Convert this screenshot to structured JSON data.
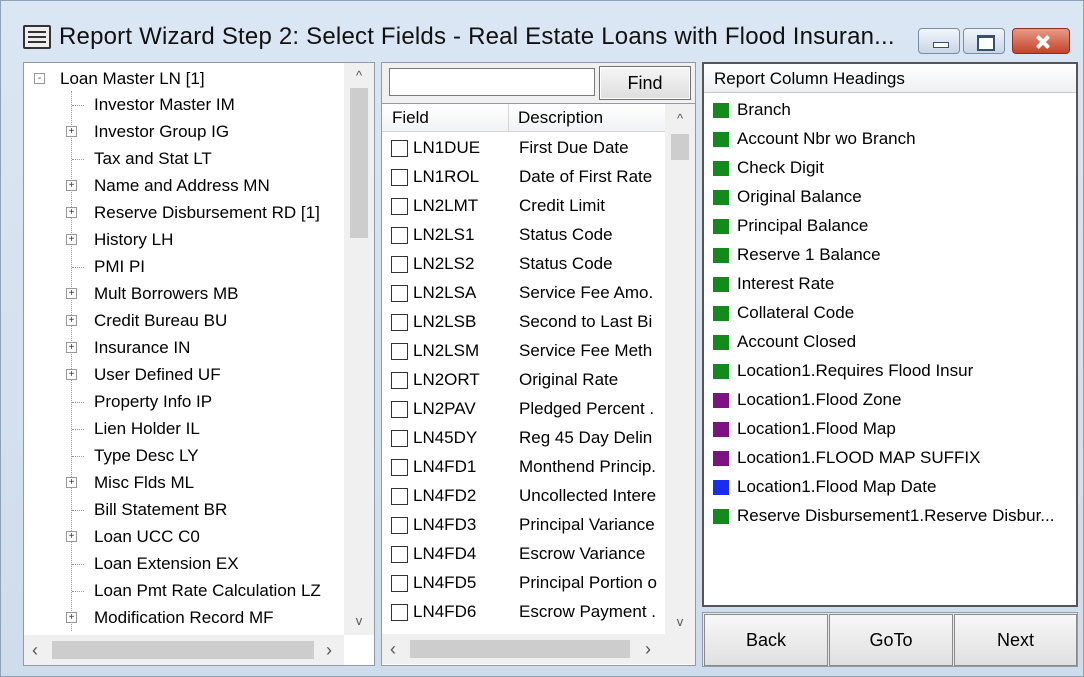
{
  "window": {
    "title": "Report Wizard Step 2:  Select Fields - Real Estate Loans with Flood Insuran..."
  },
  "tree": {
    "items": [
      {
        "label": "Loan Master LN [1]",
        "expander": "minus",
        "root": true
      },
      {
        "label": "Investor Master IM",
        "expander": ""
      },
      {
        "label": "Investor Group IG",
        "expander": "plus"
      },
      {
        "label": "Tax and Stat LT",
        "expander": ""
      },
      {
        "label": "Name and Address MN",
        "expander": "plus"
      },
      {
        "label": "Reserve Disbursement RD [1]",
        "expander": "plus"
      },
      {
        "label": "History LH",
        "expander": "plus"
      },
      {
        "label": "PMI PI",
        "expander": ""
      },
      {
        "label": "Mult Borrowers MB",
        "expander": "plus"
      },
      {
        "label": "Credit Bureau BU",
        "expander": "plus"
      },
      {
        "label": "Insurance IN",
        "expander": "plus"
      },
      {
        "label": "User Defined UF",
        "expander": "plus"
      },
      {
        "label": "Property Info IP",
        "expander": ""
      },
      {
        "label": "Lien Holder IL",
        "expander": ""
      },
      {
        "label": "Type Desc LY",
        "expander": ""
      },
      {
        "label": "Misc Flds ML",
        "expander": "plus"
      },
      {
        "label": "Bill Statement BR",
        "expander": ""
      },
      {
        "label": "Loan UCC C0",
        "expander": "plus"
      },
      {
        "label": "Loan Extension EX",
        "expander": ""
      },
      {
        "label": "Loan Pmt Rate Calculation LZ",
        "expander": ""
      },
      {
        "label": "Modification Record MF",
        "expander": "plus"
      }
    ]
  },
  "search": {
    "value": "",
    "find_label": "Find"
  },
  "fields": {
    "columns": [
      "Field",
      "Description"
    ],
    "rows": [
      {
        "code": "LN1DUE",
        "desc": "First Due Date"
      },
      {
        "code": "LN1ROL",
        "desc": "Date of First Rate"
      },
      {
        "code": "LN2LMT",
        "desc": "Credit Limit"
      },
      {
        "code": "LN2LS1",
        "desc": "Status Code"
      },
      {
        "code": "LN2LS2",
        "desc": "Status Code"
      },
      {
        "code": "LN2LSA",
        "desc": "Service Fee Amo."
      },
      {
        "code": "LN2LSB",
        "desc": "Second to Last Bi"
      },
      {
        "code": "LN2LSM",
        "desc": "Service Fee Meth"
      },
      {
        "code": "LN2ORT",
        "desc": "Original Rate"
      },
      {
        "code": "LN2PAV",
        "desc": "Pledged Percent ."
      },
      {
        "code": "LN45DY",
        "desc": "Reg 45 Day Delin"
      },
      {
        "code": "LN4FD1",
        "desc": "Monthend Princip."
      },
      {
        "code": "LN4FD2",
        "desc": "Uncollected Intere"
      },
      {
        "code": "LN4FD3",
        "desc": "Principal Variance"
      },
      {
        "code": "LN4FD4",
        "desc": "Escrow Variance"
      },
      {
        "code": "LN4FD5",
        "desc": "Principal Portion o"
      },
      {
        "code": "LN4FD6",
        "desc": "Escrow Payment ."
      }
    ]
  },
  "headings": {
    "title": "Report Column Headings",
    "colors": {
      "green": "#138a1c",
      "purple": "#7d1383",
      "blue": "#1a2cf0"
    },
    "items": [
      {
        "label": "Branch",
        "color": "green"
      },
      {
        "label": "Account Nbr wo Branch",
        "color": "green"
      },
      {
        "label": "Check Digit",
        "color": "green"
      },
      {
        "label": "Original Balance",
        "color": "green"
      },
      {
        "label": "Principal Balance",
        "color": "green"
      },
      {
        "label": "Reserve 1 Balance",
        "color": "green"
      },
      {
        "label": "Interest Rate",
        "color": "green"
      },
      {
        "label": "Collateral Code",
        "color": "green"
      },
      {
        "label": "Account Closed",
        "color": "green"
      },
      {
        "label": "Location1.Requires Flood Insur",
        "color": "green"
      },
      {
        "label": "Location1.Flood Zone",
        "color": "purple"
      },
      {
        "label": "Location1.Flood Map",
        "color": "purple"
      },
      {
        "label": "Location1.FLOOD MAP SUFFIX",
        "color": "purple"
      },
      {
        "label": "Location1.Flood Map Date",
        "color": "blue"
      },
      {
        "label": "Reserve Disbursement1.Reserve Disbur...",
        "color": "green"
      }
    ]
  },
  "nav": {
    "back_label": "Back",
    "goto_label": "GoTo",
    "next_label": "Next"
  }
}
